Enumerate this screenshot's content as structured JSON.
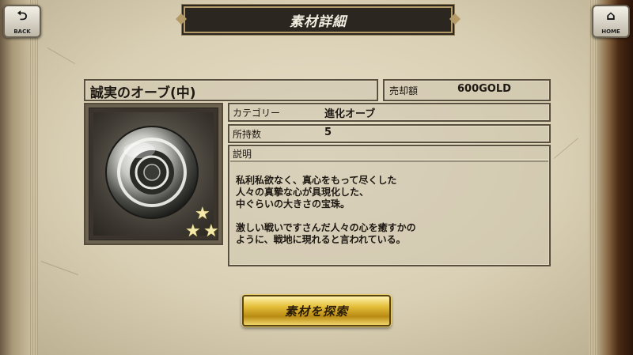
{
  "header": {
    "title": "素材詳細",
    "back_label": "BACK",
    "home_label": "HOME"
  },
  "item": {
    "name": "誠実のオーブ(中)",
    "price_label": "売却額",
    "price_value": "600GOLD",
    "category_label": "カテゴリー",
    "category_value": "進化オーブ",
    "owned_label": "所持数",
    "owned_value": "5",
    "description_label": "説明",
    "description_lines": [
      "私利私欲なく、真心をもって尽くした",
      "人々の真摯な心が具現化した、",
      "中ぐらいの大きさの宝珠。",
      "",
      "激しい戦いですさんだ人々の心を癒すかの",
      "ように、戦地に現れると言われている。"
    ],
    "rarity_stars": 3,
    "image_icon": "orb-icon"
  },
  "actions": {
    "search_button_label": "素材を探索"
  },
  "colors": {
    "gold_button": "#e5bf3a",
    "title_bar": "#2b2620",
    "star": "#f4e9a8"
  }
}
